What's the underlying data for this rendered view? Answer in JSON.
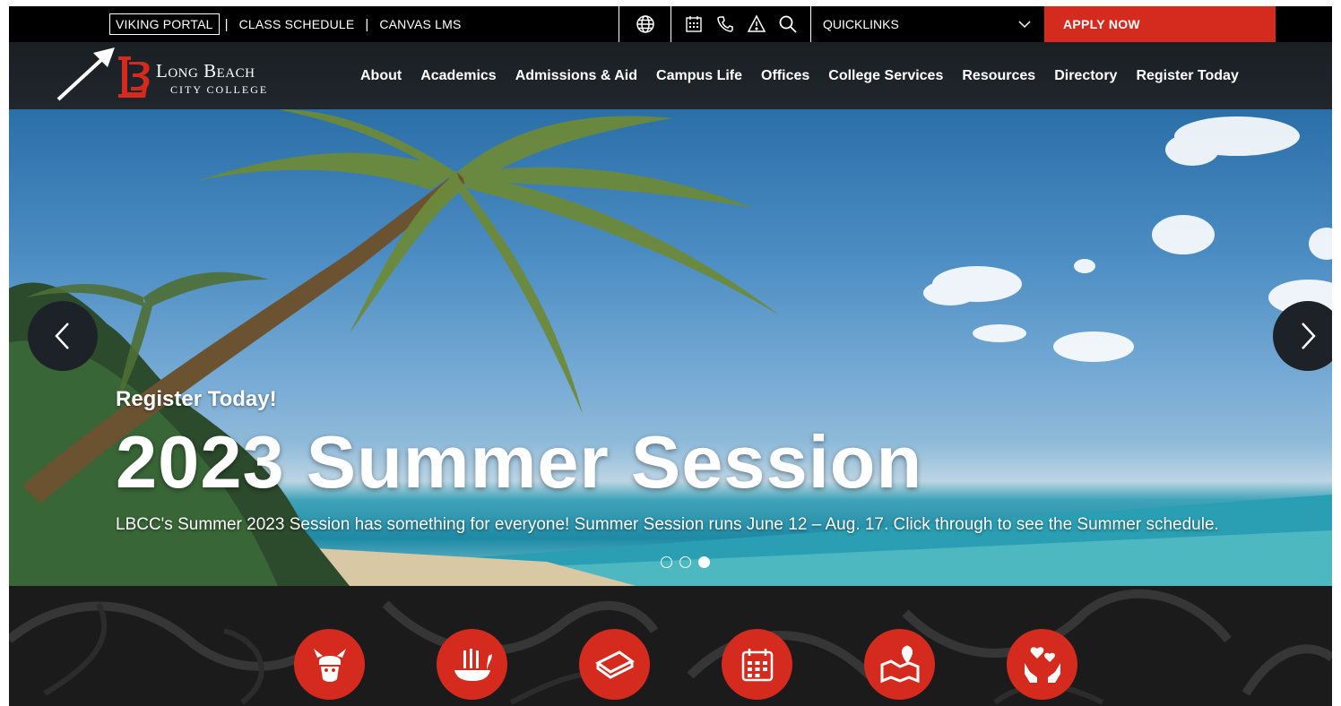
{
  "utility": {
    "links": [
      {
        "label": "VIKING PORTAL"
      },
      {
        "label": "CLASS SCHEDULE"
      },
      {
        "label": "CANVAS LMS"
      }
    ],
    "icons": [
      "globe-icon",
      "calendar-icon",
      "phone-icon",
      "alert-icon",
      "search-icon"
    ],
    "quicklinks_label": "QUICKLINKS",
    "apply_label": "APPLY NOW"
  },
  "nav": {
    "logo": {
      "line1": "Long Beach",
      "line2": "City College"
    },
    "items": [
      "About",
      "Academics",
      "Admissions & Aid",
      "Campus Life",
      "Offices",
      "College Services",
      "Resources",
      "Directory",
      "Register Today"
    ]
  },
  "hero": {
    "kicker": "Register Today!",
    "title": "2023 Summer Session",
    "description": "LBCC's Summer 2023 Session has something for everyone! Summer Session runs June 12 – Aug. 17. Click through to see the Summer schedule.",
    "slides_total": 3,
    "active_slide": 3
  },
  "quick_icons": [
    "viking-mascot-icon",
    "viking-ship-icon",
    "books-icon",
    "calendar-icon",
    "map-location-icon",
    "hands-hearts-icon"
  ],
  "colors": {
    "accent_red": "#d52b1e",
    "nav_bg": "#1f2429",
    "utility_bg": "#000000"
  }
}
